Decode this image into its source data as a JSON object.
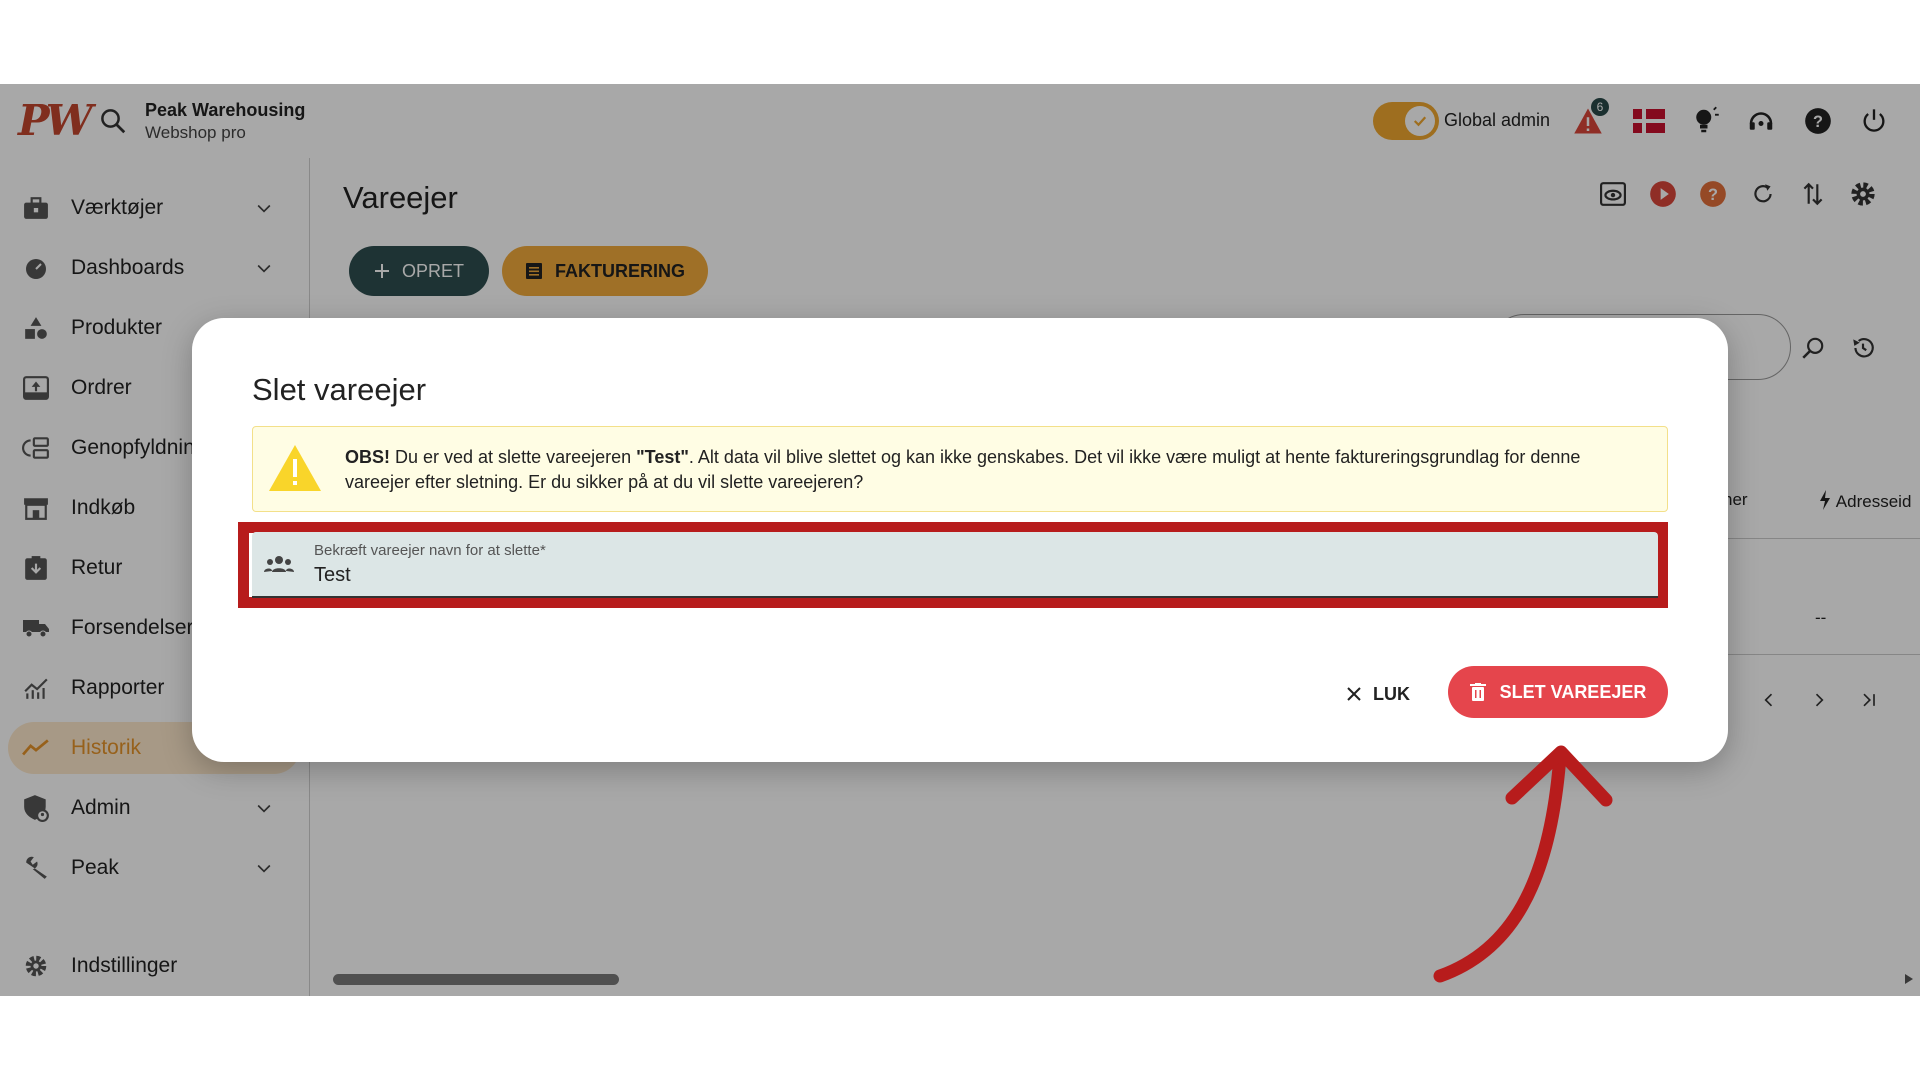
{
  "topbar": {
    "logo": "PW",
    "brand_name": "Peak Warehousing",
    "brand_sub": "Webshop pro",
    "global_admin": "Global admin",
    "notification_count": "6"
  },
  "sidebar": {
    "items": [
      {
        "label": "Værktøjer"
      },
      {
        "label": "Dashboards"
      },
      {
        "label": "Produkter"
      },
      {
        "label": "Ordrer"
      },
      {
        "label": "Genopfyldning"
      },
      {
        "label": "Indkøb"
      },
      {
        "label": "Retur"
      },
      {
        "label": "Forsendelser"
      },
      {
        "label": "Rapporter"
      },
      {
        "label": "Historik"
      },
      {
        "label": "Admin"
      },
      {
        "label": "Peak"
      },
      {
        "label": "Indstillinger"
      }
    ]
  },
  "main": {
    "title": "Vareejer",
    "opret_label": "OPRET",
    "fakturering_label": "FAKTURERING",
    "col_header_1": "ner",
    "col_header_2": "Adresseid",
    "cell_value": "--"
  },
  "dialog": {
    "title": "Slet vareejer",
    "warn_obs": "OBS!",
    "warn_part1": " Du er ved at slette vareejeren ",
    "warn_name": "\"Test\"",
    "warn_part2": ". Alt data vil blive slettet og kan ikke genskabes. Det vil ikke være muligt at hente faktureringsgrundlag for denne vareejer efter sletning. Er du sikker på at du vil slette vareejeren?",
    "input_label": "Bekræft vareejer navn for at slette*",
    "input_value": "Test",
    "close_label": "LUK",
    "delete_label": "SLET VAREEJER"
  },
  "colors": {
    "accent_dark": "#2e4e4f",
    "accent_orange": "#f2ab3c",
    "danger": "#e5454c",
    "highlight_red": "#b71c1c"
  }
}
